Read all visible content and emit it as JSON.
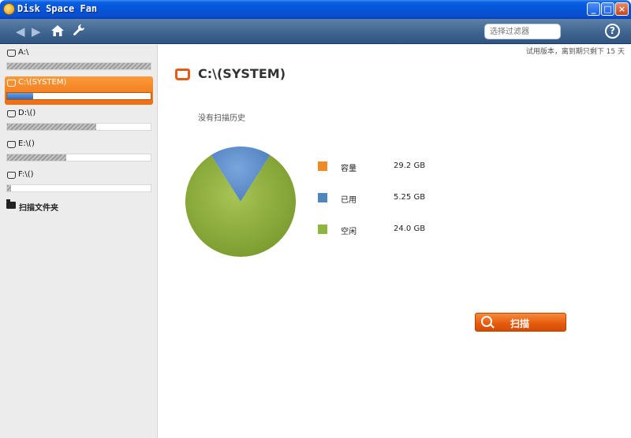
{
  "window": {
    "title": "Disk Space Fan"
  },
  "toolbar": {
    "back_icon": "arrow-left-icon",
    "forward_icon": "arrow-right-icon",
    "home_icon": "home-icon",
    "tools_icon": "wrench-icon",
    "search_placeholder": "选择过滤器",
    "help_label": "?"
  },
  "sidebar": {
    "drives": [
      {
        "label": "A:\\",
        "used_fraction": 1.0,
        "selected": false
      },
      {
        "label": "C:\\(SYSTEM)",
        "used_fraction": 0.18,
        "selected": true
      },
      {
        "label": "D:\\()",
        "used_fraction": 0.62,
        "selected": false
      },
      {
        "label": "E:\\()",
        "used_fraction": 0.41,
        "selected": false
      },
      {
        "label": "F:\\()",
        "used_fraction": 0.03,
        "selected": false
      }
    ],
    "scan_folder_label": "扫描文件夹"
  },
  "main": {
    "trial_notice": "试用版本，离到期只剩下 15 天",
    "drive_title": "C:\\(SYSTEM)",
    "no_history": "没有扫描历史",
    "legend": [
      {
        "name": "容量",
        "value": "29.2 GB",
        "color": "#f08a26"
      },
      {
        "name": "已用",
        "value": "5.25 GB",
        "color": "#4f86c0"
      },
      {
        "name": "空闲",
        "value": "24.0 GB",
        "color": "#8db540"
      }
    ],
    "scan_button": "扫描"
  },
  "colors": {
    "accent_orange": "#ee6d10",
    "pie_used": "#5d8dcc",
    "pie_free": "#8cab3c"
  },
  "chart_data": {
    "type": "pie",
    "title": "",
    "slices": [
      {
        "name": "已用",
        "value": 5.25
      },
      {
        "name": "空闲",
        "value": 24.0
      }
    ]
  }
}
